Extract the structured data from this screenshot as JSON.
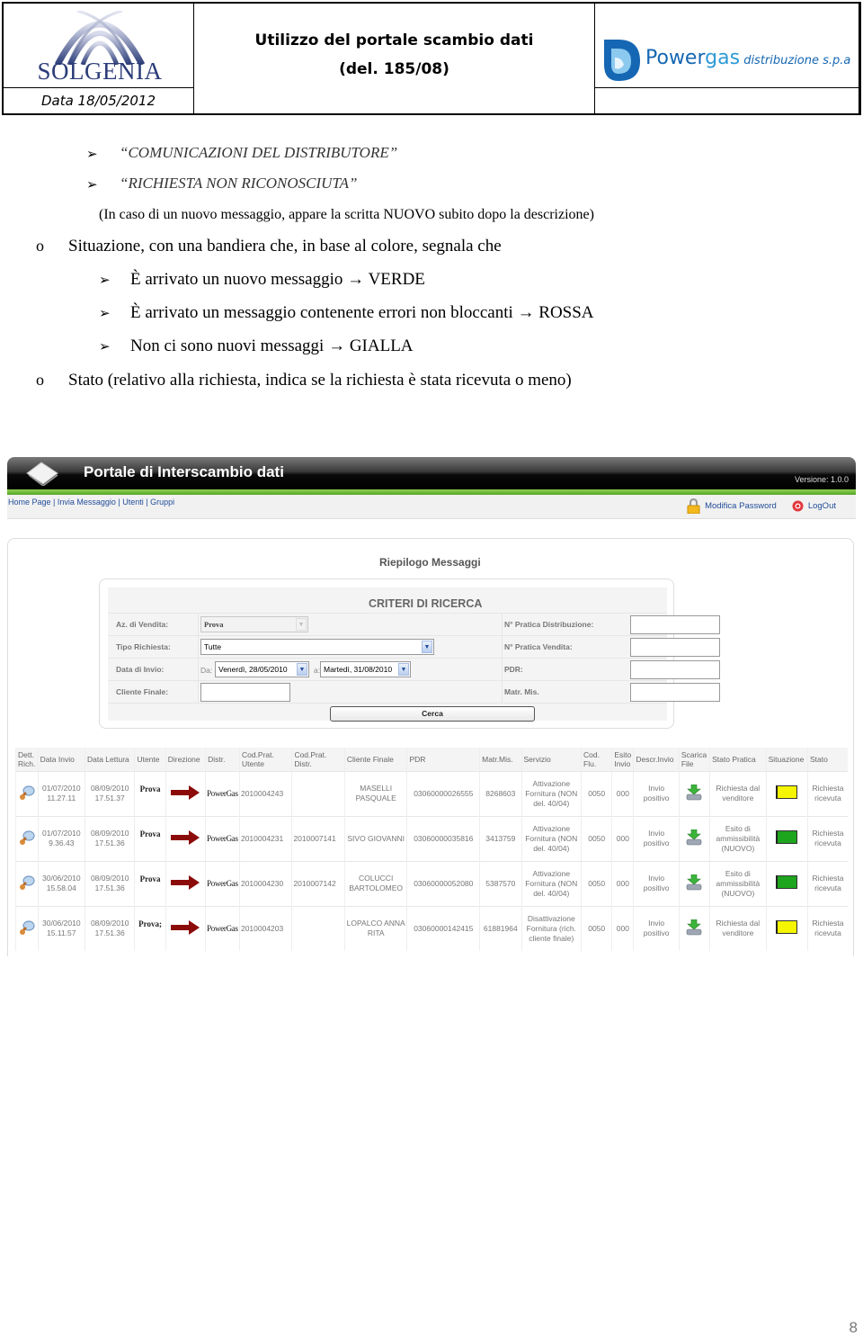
{
  "doc_header": {
    "left_logo_text": "SOLGENIA",
    "date": "Data 18/05/2012",
    "title_line1": "Utilizzo del portale scambio dati",
    "title_line2": "(del. 185/08)",
    "right_logo_power": "Power",
    "right_logo_gas": "gas",
    "right_logo_suffix": " distribuzione s.p.a"
  },
  "body_text": {
    "sub_bullets_top": [
      "“COMUNICAZIONI DEL DISTRIBUTORE”",
      "“RICHIESTA NON RICONOSCIUTA”"
    ],
    "note": "(In caso di un nuovo messaggio, appare la scritta NUOVO subito dopo la descrizione)",
    "item_situazione": "Situazione, con una bandiera che, in base al colore, segnala che",
    "flag_rules": [
      {
        "text": "È arrivato un nuovo messaggio",
        "arrow": "→",
        "color_name": "VERDE"
      },
      {
        "text": "È arrivato un messaggio contenente errori non bloccanti",
        "arrow": "→",
        "color_name": "ROSSA"
      },
      {
        "text": "Non ci sono nuovi messaggi",
        "arrow": "→",
        "color_name": "GIALLA"
      }
    ],
    "item_stato": "Stato (relativo alla richiesta, indica se la richiesta è stata ricevuta o meno)",
    "bullet_o": "o",
    "bullet_arrow": "➢"
  },
  "portal": {
    "title": "Portale di Interscambio dati",
    "version": "Versione: 1.0.0",
    "nav": [
      "Home Page",
      "Invia Messaggio",
      "Utenti",
      "Gruppi"
    ],
    "nav_sep": " | ",
    "change_password": "Modifica Password",
    "logout": "LogOut",
    "panel_title": "Riepilogo Messaggi",
    "criteria": {
      "title": "CRITERI DI RICERCA",
      "az_vendita_label": "Az. di Vendita:",
      "az_vendita_value": "Prova",
      "tipo_richiesta_label": "Tipo Richiesta:",
      "tipo_richiesta_value": "Tutte",
      "data_invio_label": "Data di Invio:",
      "da_label": "Da:",
      "da_value": "Venerdì, 28/05/2010",
      "a_label": "a:",
      "a_value": "Martedì, 31/08/2010",
      "cliente_finale_label": "Cliente Finale:",
      "cliente_finale_value": "",
      "n_pratica_distr_label": "N° Pratica Distribuzione:",
      "n_pratica_distr_value": "",
      "n_pratica_vendita_label": "N° Pratica Vendita:",
      "n_pratica_vendita_value": "",
      "pdr_label": "PDR:",
      "pdr_value": "",
      "matr_mis_label": "Matr. Mis.",
      "matr_mis_value": "",
      "search_button": "Cerca",
      "dropdown_glyph": "▼"
    },
    "table": {
      "columns": [
        "Dett. Rich.",
        "Data Invio",
        "Data Lettura",
        "Utente",
        "Direzione",
        "Distr.",
        "Cod.Prat. Utente",
        "Cod.Prat. Distr.",
        "Cliente Finale",
        "PDR",
        "Matr.Mis.",
        "Servizio",
        "Cod. Flu.",
        "Esito Invio",
        "Descr.Invio",
        "Scarica File",
        "Stato Pratica",
        "Situazione",
        "Stato"
      ],
      "rows": [
        {
          "data_invio": "01/07/2010 11.27.11",
          "data_lettura": "08/09/2010 17.51.37",
          "utente": "Prova",
          "distr": "PowerGas",
          "cod_prat_utente": "2010004243",
          "cod_prat_distr": "",
          "cliente_finale": "MASELLI PASQUALE",
          "pdr": "03060000026555",
          "matr_mis": "8268603",
          "servizio": "Attivazione Fornitura (NON del. 40/04)",
          "cod_flu": "0050",
          "esito_invio": "000",
          "descr_invio": "Invio positivo",
          "stato_pratica": "Richiesta dal venditore",
          "situazione_color": "#f5f500",
          "stato": "Richiesta ricevuta"
        },
        {
          "data_invio": "01/07/2010 9.36.43",
          "data_lettura": "08/09/2010 17.51.36",
          "utente": "Prova",
          "distr": "PowerGas",
          "cod_prat_utente": "2010004231",
          "cod_prat_distr": "2010007141",
          "cliente_finale": "SIVO GIOVANNI",
          "pdr": "03060000035816",
          "matr_mis": "3413759",
          "servizio": "Attivazione Fornitura (NON del. 40/04)",
          "cod_flu": "0050",
          "esito_invio": "000",
          "descr_invio": "Invio positivo",
          "stato_pratica": "Esito di ammissibilità (NUOVO)",
          "situazione_color": "#1ea51e",
          "stato": "Richiesta ricevuta"
        },
        {
          "data_invio": "30/06/2010 15.58.04",
          "data_lettura": "08/09/2010 17.51.36",
          "utente": "Prova",
          "distr": "PowerGas",
          "cod_prat_utente": "2010004230",
          "cod_prat_distr": "2010007142",
          "cliente_finale": "COLUCCI BARTOLOMEO",
          "pdr": "03060000052080",
          "matr_mis": "5387570",
          "servizio": "Attivazione Fornitura (NON del. 40/04)",
          "cod_flu": "0050",
          "esito_invio": "000",
          "descr_invio": "Invio positivo",
          "stato_pratica": "Esito di ammissibilità (NUOVO)",
          "situazione_color": "#1ea51e",
          "stato": "Richiesta ricevuta"
        },
        {
          "data_invio": "30/06/2010 15.11.57",
          "data_lettura": "08/09/2010 17.51.36",
          "utente": "Prova;",
          "distr": "PowerGas",
          "cod_prat_utente": "2010004203",
          "cod_prat_distr": "",
          "cliente_finale": "LOPALCO ANNA RITA",
          "pdr": "03060000142415",
          "matr_mis": "61881964",
          "servizio": "Disattivazione Fornitura (rich. cliente finale)",
          "cod_flu": "0050",
          "esito_invio": "000",
          "descr_invio": "Invio positivo",
          "stato_pratica": "Richiesta dal venditore",
          "situazione_color": "#f5f500",
          "stato": "Richiesta ricevuta"
        }
      ]
    }
  },
  "page_number": "8",
  "colors": {
    "portal_green": "#6cbf3a",
    "link_blue": "#224e9b",
    "arrow_red": "#8b0a0a",
    "flag_yellow": "#f5f500",
    "flag_green": "#1ea51e",
    "solgenia_blue": "#2b3c78",
    "powergas_blue": "#1667b3"
  }
}
